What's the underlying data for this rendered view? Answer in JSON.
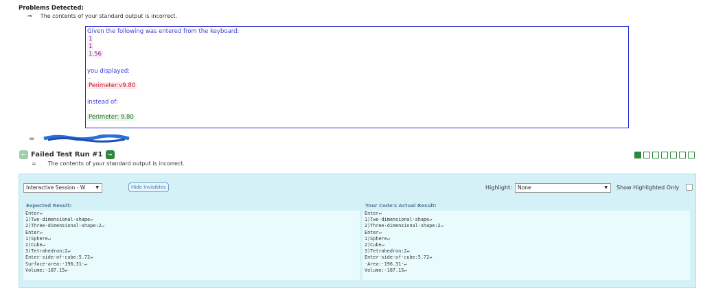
{
  "problems": {
    "title": "Problems Detected:",
    "arrow": "⇒",
    "message": "The contents of your standard output is incorrect."
  },
  "feedback": {
    "given_label": "Given the following was entered from the keyboard:",
    "inputs": [
      "1",
      "1",
      "1.56"
    ],
    "displayed_label": "you displayed:",
    "dots": "...",
    "displayed_value": "Perimeter:v9.80",
    "instead_label": "instead of:",
    "expected_value": "Perimeter: 9.80"
  },
  "failed": {
    "eq_top": "=",
    "title": "Failed Test Run #1",
    "eq": "=",
    "message": "The contents of your standard output is incorrect.",
    "prev_icon": "←",
    "next_icon": "→",
    "progress_total": 7,
    "progress_active": 1
  },
  "controls": {
    "session_select": "Interactive Session - W",
    "hide_invisibles": "Hide Invisibles",
    "highlight_label": "Highlight:",
    "highlight_value": "None",
    "show_highlighted": "Show Highlighted Only",
    "caret": "▼"
  },
  "expected": {
    "header": "Expected Result:",
    "lines": [
      "Enter↵",
      "1)Two·dimensional·shape↵",
      "2)Three·dimensional·shape:2↵",
      "Enter↵",
      "1)Sphere↵",
      "2)Cube↵",
      "3)Tetrahedron:2↵",
      "Enter·side·of·cube:5.72↵",
      "Surface·area:·196.31·↵",
      "Volume:·187.15↵"
    ]
  },
  "actual": {
    "header": "Your Code's Actual Result:",
    "lines": [
      "Enter↵",
      "1)Two·dimensional·shape↵",
      "2)Three·dimensional·shape:2↵",
      "Enter↵",
      "1)Sphere↵",
      "2)Cube↵",
      "3)Tetrahedron:2↵",
      "Enter·side·of·cube:5.72↵",
      "·Area:·196.31·↵",
      "Volume:·187.15↵"
    ]
  },
  "colors": {
    "accent_green": "#2c8a3c",
    "panel_bg": "#d4f1f7",
    "feedback_border": "#2b2bd6",
    "error_red": "#c4122f"
  }
}
